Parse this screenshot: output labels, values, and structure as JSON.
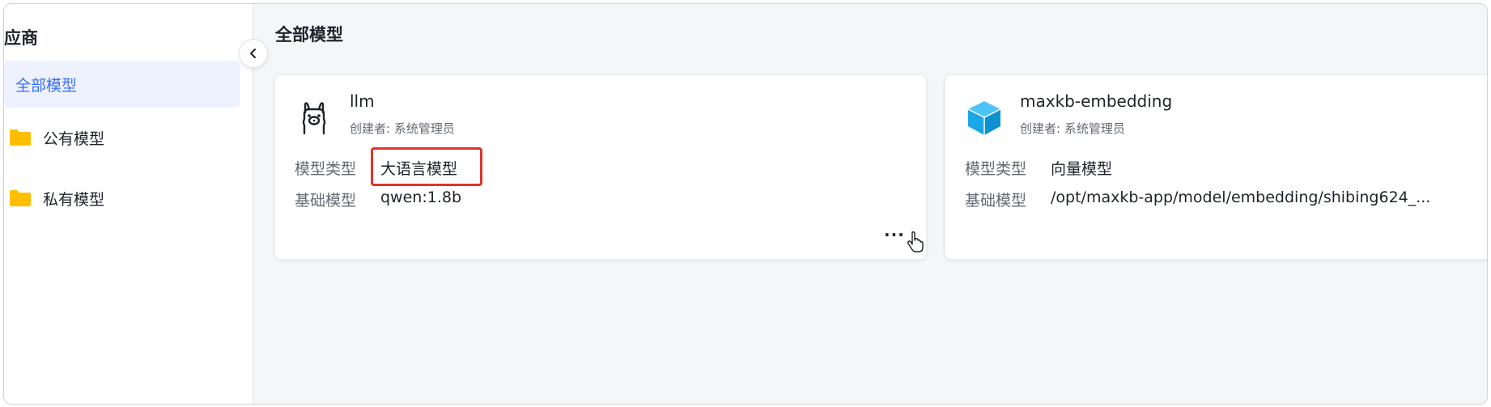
{
  "sidebar": {
    "title": "应商",
    "items": [
      {
        "label": "全部模型",
        "active": true
      },
      {
        "label": "公有模型",
        "icon": "folder-icon"
      },
      {
        "label": "私有模型",
        "icon": "folder-icon"
      }
    ]
  },
  "main": {
    "title": "全部模型",
    "cards": [
      {
        "name": "llm",
        "creator": "创建者: 系统管理员",
        "icon": "ollama-llama-icon",
        "type_label": "模型类型",
        "type_value": "大语言模型",
        "base_label": "基础模型",
        "base_value": "qwen:1.8b",
        "more": "..."
      },
      {
        "name": "maxkb-embedding",
        "creator": "创建者: 系统管理员",
        "icon": "cube-icon",
        "type_label": "模型类型",
        "type_value": "向量模型",
        "base_label": "基础模型",
        "base_value": "/opt/maxkb-app/model/embedding/shibing624_..."
      }
    ]
  },
  "colors": {
    "accent": "#3370ff",
    "active_bg": "#eef1fe",
    "folder": "#ffbf00",
    "highlight": "#e0342c",
    "cube": "#1aa7e8"
  }
}
